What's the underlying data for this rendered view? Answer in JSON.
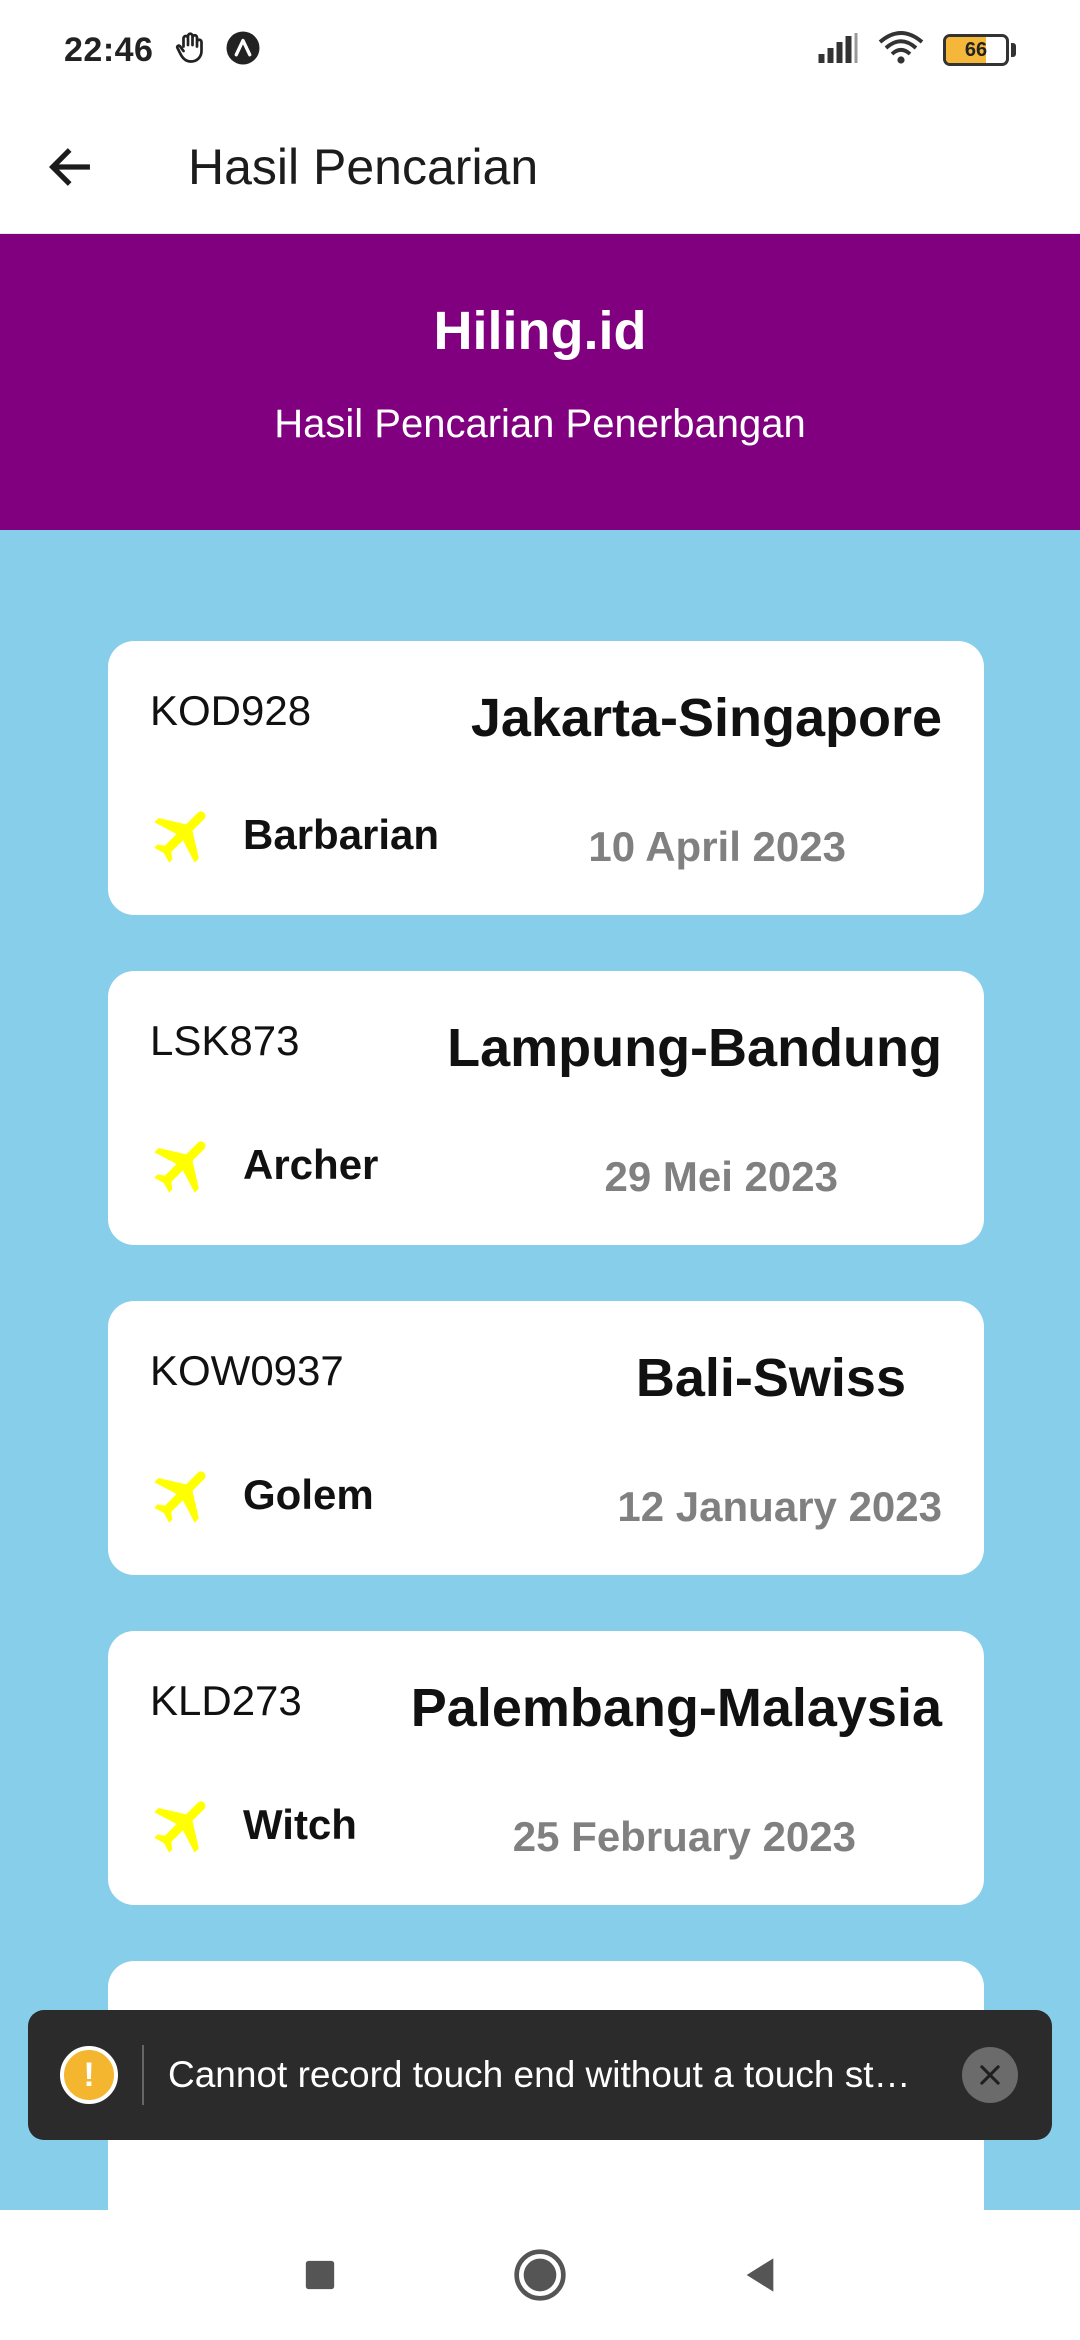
{
  "status_bar": {
    "time": "22:46",
    "battery_level": "66",
    "icons": [
      "hand-shield-icon",
      "a-circle-icon",
      "signal-icon",
      "wifi-icon",
      "battery-icon"
    ]
  },
  "app_bar": {
    "title": "Hasil Pencarian"
  },
  "banner": {
    "title": "Hiling.id",
    "subtitle": "Hasil Pencarian Penerbangan"
  },
  "flights": [
    {
      "code": "KOD928",
      "route": "Jakarta-Singapore",
      "airline": "Barbarian",
      "date": "10 April 2023"
    },
    {
      "code": "LSK873",
      "route": "Lampung-Bandung",
      "airline": "Archer",
      "date": "29 Mei 2023"
    },
    {
      "code": "KOW0937",
      "route": "Bali-Swiss",
      "airline": "Golem",
      "date": "12 January 2023"
    },
    {
      "code": "KLD273",
      "route": "Palembang-Malaysia",
      "airline": "Witch",
      "date": "25 February 2023"
    }
  ],
  "toast": {
    "message": "Cannot record touch end without a touch st…"
  },
  "colors": {
    "banner": "#800080",
    "content_bg": "#87ceeb",
    "plane_icon": "#ffff00",
    "date_text": "#808080",
    "toast_warning": "#f4b52f"
  }
}
